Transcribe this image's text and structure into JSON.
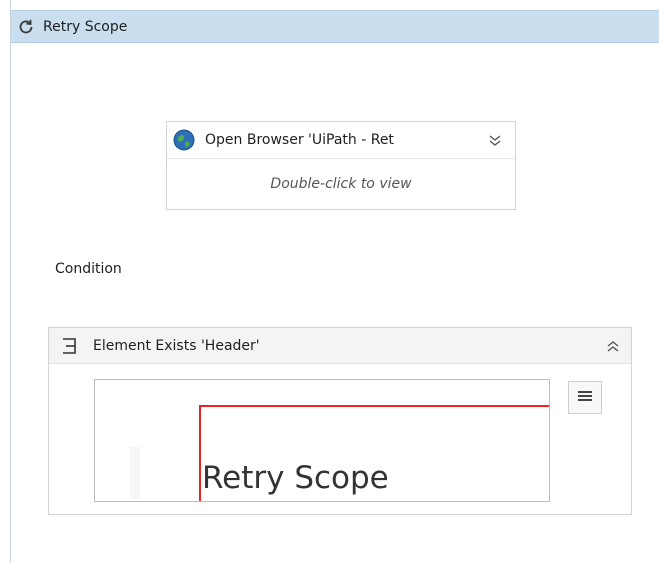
{
  "scope": {
    "title": "Retry Scope",
    "icon": "retry-icon"
  },
  "open_browser": {
    "label": "Open Browser 'UiPath - Ret",
    "hint": "Double-click to view",
    "icon": "globe-icon",
    "expand_icon": "double-chevron-down-icon"
  },
  "condition": {
    "label": "Condition"
  },
  "element_exists": {
    "label": "Element Exists 'Header'",
    "icon": "exists-icon",
    "collapse_icon": "double-chevron-up-icon",
    "preview_text": "Retry Scope",
    "menu_icon": "menu-icon"
  },
  "colors": {
    "header_bg": "#c9dff0",
    "selection": "#e22222"
  }
}
